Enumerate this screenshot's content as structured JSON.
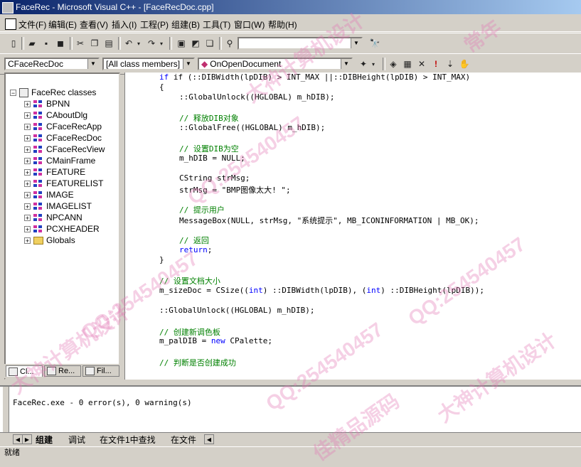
{
  "window": {
    "title": "FaceRec - Microsoft Visual C++ - [FaceRecDoc.cpp]"
  },
  "menu": [
    "文件(F)",
    "编辑(E)",
    "查看(V)",
    "插入(I)",
    "工程(P)",
    "组建(B)",
    "工具(T)",
    "窗口(W)",
    "帮助(H)"
  ],
  "wizard_bar": {
    "class_combo": "CFaceRecDoc",
    "filter_combo": "[All class members]",
    "member_combo": "OnOpenDocument"
  },
  "class_tree": {
    "root": "FaceRec classes",
    "items": [
      "BPNN",
      "CAboutDlg",
      "CFaceRecApp",
      "CFaceRecDoc",
      "CFaceRecView",
      "CMainFrame",
      "FEATURE",
      "FEATURELIST",
      "IMAGE",
      "IMAGELIST",
      "NPCANN",
      "PCXHEADER",
      "Globals"
    ]
  },
  "workspace_tabs": [
    "Cl...",
    "Re...",
    "Fil..."
  ],
  "code": {
    "l1a": "if (::DIBWidth(lpDIB) > INT_MAX ||::DIBHeight(lpDIB) > INT_MAX)",
    "l2": "{",
    "l3": "::GlobalUnlock((HGLOBAL) m_hDIB);",
    "l4": "// 释放DIB对象",
    "l5": "::GlobalFree((HGLOBAL) m_hDIB);",
    "l6": "// 设置DIB为空",
    "l7": "m_hDIB = NULL;",
    "l8": "CString strMsg;",
    "l9": "strMsg = \"BMP图像太大! \";",
    "l10": "// 提示用户",
    "l11": "MessageBox(NULL, strMsg, \"系统提示\", MB_ICONINFORMATION | MB_OK);",
    "l12": "// 返回",
    "l13kw": "return",
    "l13": ";",
    "l14": "}",
    "l15": "// 设置文档大小",
    "l16a": "m_sizeDoc = CSize((",
    "l16kw1": "int",
    "l16b": ") ::DIBWidth(lpDIB), (",
    "l16kw2": "int",
    "l16c": ") ::DIBHeight(lpDIB));",
    "l17": "::GlobalUnlock((HGLOBAL) m_hDIB);",
    "l18": "// 创建新调色板",
    "l19a": "m_palDIB = ",
    "l19kw": "new",
    "l19b": " CPalette;",
    "l20": "// 判断是否创建成功"
  },
  "output": {
    "text": "FaceRec.exe - 0 error(s), 0 warning(s)",
    "tabs": [
      "组建",
      "调试",
      "在文件1中查找",
      "在文件"
    ]
  },
  "status": "就绪",
  "watermarks": [
    "QQ:254540457",
    "大神计算机设计",
    "常年",
    "佳精品源码",
    "QQ:254540457",
    "大神计算机设计",
    "QQ:254540457",
    "大神计算机设计",
    "QQ:254540457"
  ]
}
